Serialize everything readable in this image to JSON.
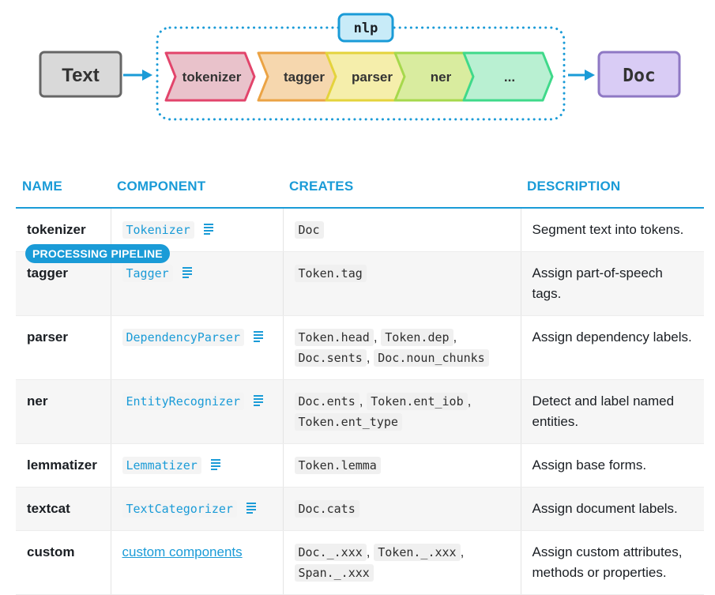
{
  "diagram": {
    "input_label": "Text",
    "output_label": "Doc",
    "container_label": "nlp",
    "stages": [
      {
        "label": "tokenizer",
        "fill": "#e9c2cb",
        "stroke": "#e2446b"
      },
      {
        "label": "tagger",
        "fill": "#f6d7ae",
        "stroke": "#eba344"
      },
      {
        "label": "parser",
        "fill": "#f5eeab",
        "stroke": "#e4d33c"
      },
      {
        "label": "ner",
        "fill": "#d9ec9f",
        "stroke": "#a6d84c"
      },
      {
        "label": "...",
        "fill": "#b9f0d2",
        "stroke": "#3fd98a"
      }
    ],
    "colors": {
      "accent": "#1a9bd7",
      "text_box_fill": "#d9d9d9",
      "text_box_stroke": "#666666",
      "doc_box_fill": "#d9ccf5",
      "doc_box_stroke": "#8e78c4",
      "nlp_badge_fill": "#c8ebf8"
    }
  },
  "badge": {
    "label": "PROCESSING PIPELINE"
  },
  "table": {
    "headers": [
      "NAME",
      "COMPONENT",
      "CREATES",
      "DESCRIPTION"
    ],
    "rows": [
      {
        "name": "tokenizer",
        "component": "Tokenizer",
        "creates": [
          "Doc"
        ],
        "description": "Segment text into tokens."
      },
      {
        "name": "tagger",
        "component": "Tagger",
        "creates": [
          "Token.tag"
        ],
        "description": "Assign part-of-speech tags."
      },
      {
        "name": "parser",
        "component": "DependencyParser",
        "creates": [
          "Token.head",
          "Token.dep",
          "Doc.sents",
          "Doc.noun_chunks"
        ],
        "description": "Assign dependency labels."
      },
      {
        "name": "ner",
        "component": "EntityRecognizer",
        "creates": [
          "Doc.ents",
          "Token.ent_iob",
          "Token.ent_type"
        ],
        "description": "Detect and label named entities."
      },
      {
        "name": "lemmatizer",
        "component": "Lemmatizer",
        "creates": [
          "Token.lemma"
        ],
        "description": "Assign base forms."
      },
      {
        "name": "textcat",
        "component": "TextCategorizer",
        "creates": [
          "Doc.cats"
        ],
        "description": "Assign document labels."
      },
      {
        "name": "custom",
        "component": "custom components",
        "component_is_link": true,
        "creates": [
          "Doc._.xxx",
          "Token._.xxx",
          "Span._.xxx"
        ],
        "description": "Assign custom attributes, methods or properties."
      }
    ]
  }
}
